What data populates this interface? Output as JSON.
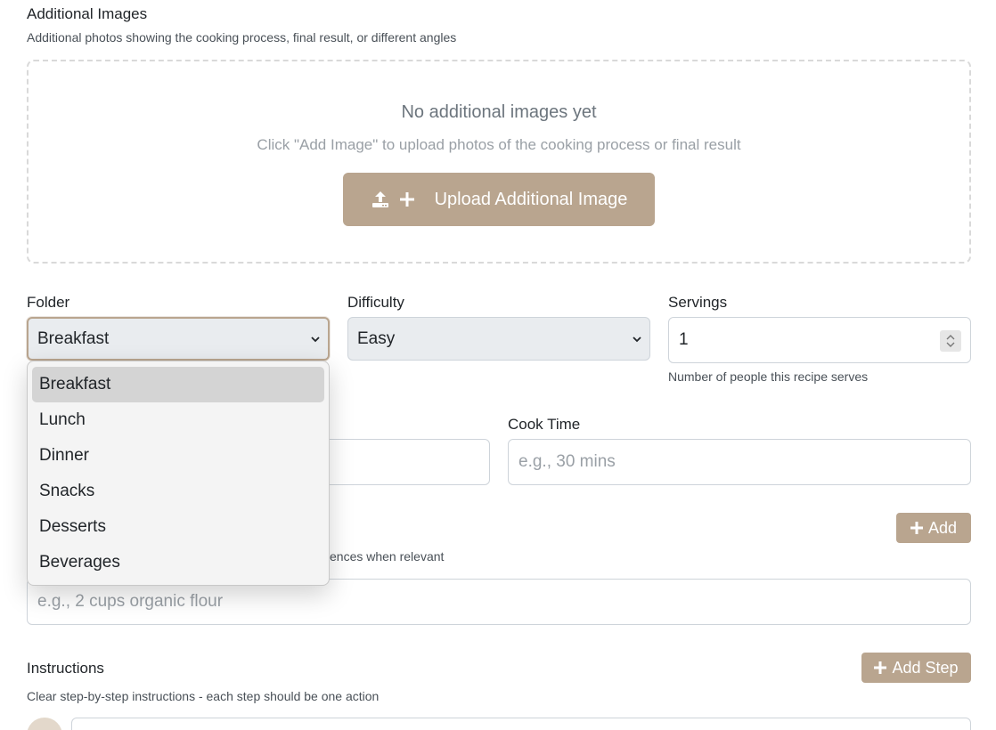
{
  "additional_images": {
    "label": "Additional Images",
    "help": "Additional photos showing the cooking process, final result, or different angles",
    "empty_title": "No additional images yet",
    "empty_sub": "Click \"Add Image\" to upload photos of the cooking process or final result",
    "upload_label": "Upload Additional Image"
  },
  "folder": {
    "label": "Folder",
    "value": "Breakfast",
    "options": [
      "Breakfast",
      "Lunch",
      "Dinner",
      "Snacks",
      "Desserts",
      "Beverages"
    ]
  },
  "difficulty": {
    "label": "Difficulty",
    "value": "Easy"
  },
  "servings": {
    "label": "Servings",
    "value": "1",
    "help": "Number of people this recipe serves"
  },
  "cook_time": {
    "label": "Cook Time",
    "placeholder": "e.g., 30 mins"
  },
  "ingredients": {
    "help_fragment": "ences when relevant",
    "add_label": "Add",
    "placeholder": "e.g., 2 cups organic flour"
  },
  "instructions": {
    "label": "Instructions",
    "help": "Clear step-by-step instructions - each step should be one action",
    "add_step_label": "Add Step"
  },
  "colors": {
    "accent": "#b9a58f",
    "focus_border": "#b9a58f",
    "select_bg": "#e9ecef"
  }
}
